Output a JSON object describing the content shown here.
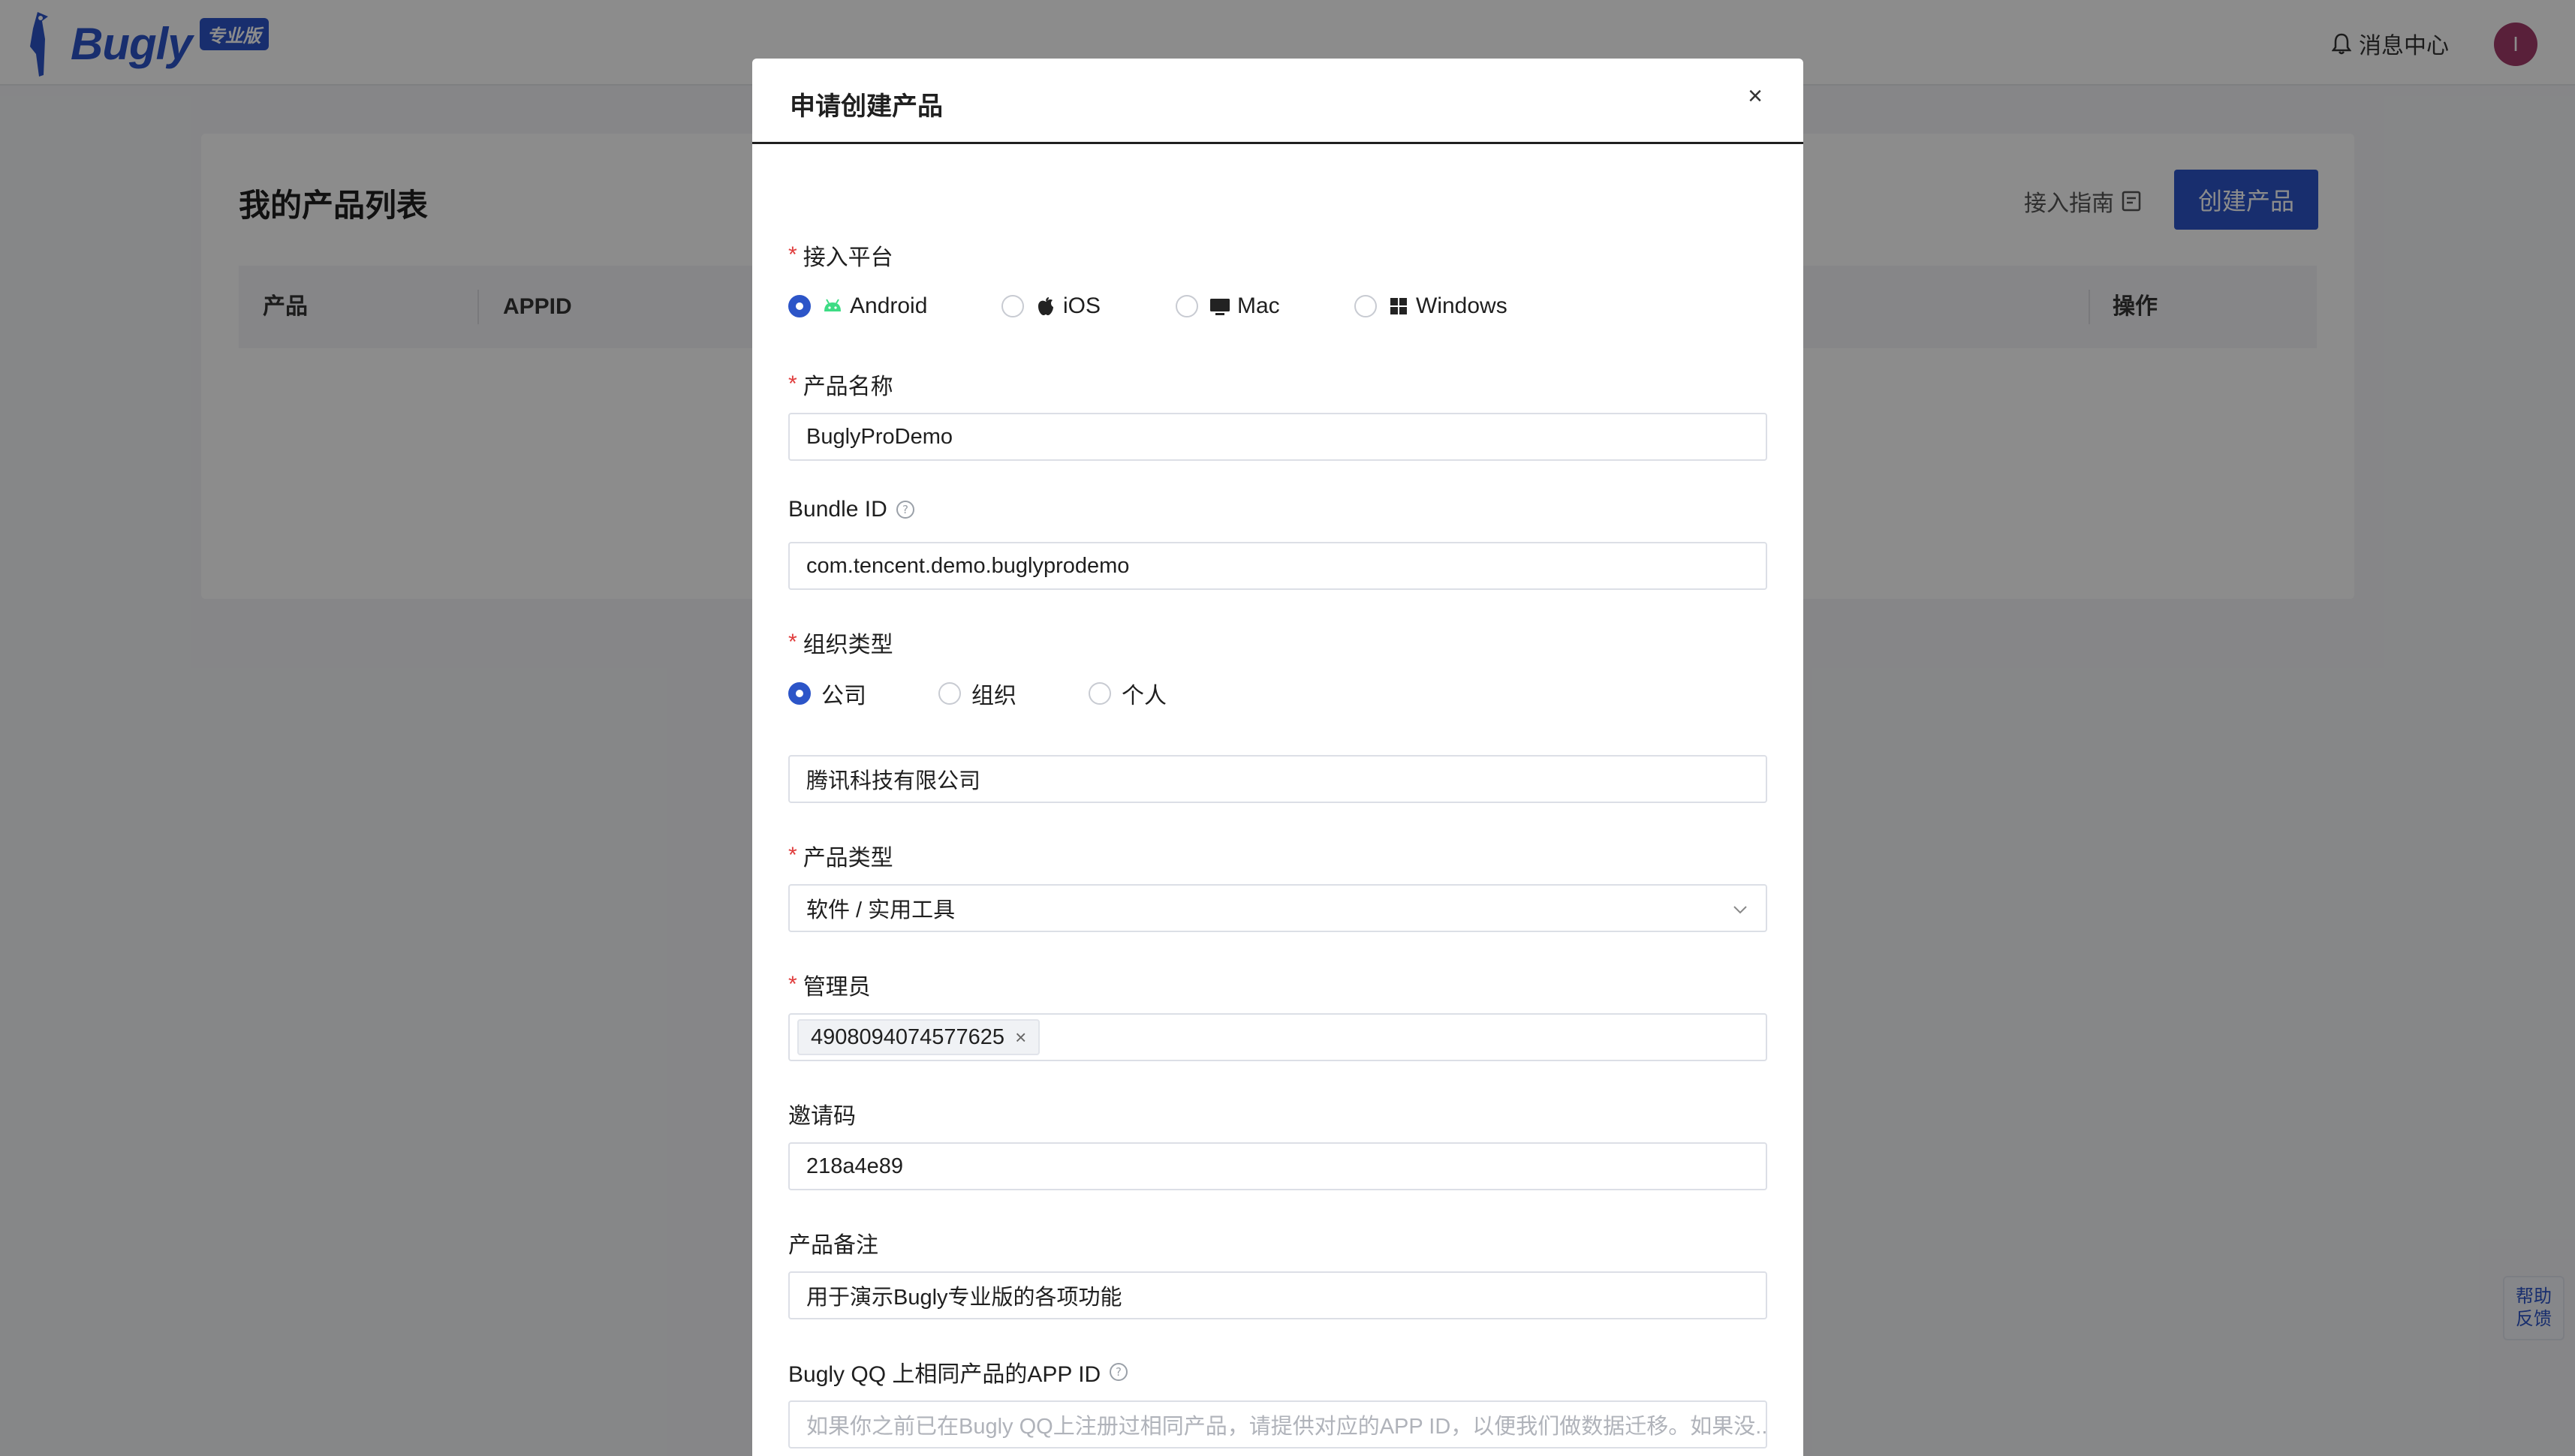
{
  "header": {
    "logo_text": "Bugly",
    "logo_badge": "专业版",
    "message_center": "消息中心",
    "avatar_initial": "I"
  },
  "page": {
    "title": "我的产品列表",
    "guide_link": "接入指南",
    "create_button": "创建产品",
    "table_headers": [
      "产品",
      "APPID",
      "操作"
    ]
  },
  "modal": {
    "title": "申请创建产品",
    "close": "×",
    "platform": {
      "label": "接入平台",
      "options": [
        "Android",
        "iOS",
        "Mac",
        "Windows"
      ],
      "selected": "Android"
    },
    "product_name": {
      "label": "产品名称",
      "value": "BuglyProDemo"
    },
    "bundle_id": {
      "label": "Bundle ID",
      "value": "com.tencent.demo.buglyprodemo"
    },
    "org_type": {
      "label": "组织类型",
      "options": [
        "公司",
        "组织",
        "个人"
      ],
      "selected": "公司",
      "company_value": "腾讯科技有限公司"
    },
    "product_type": {
      "label": "产品类型",
      "value": "软件 / 实用工具"
    },
    "admin": {
      "label": "管理员",
      "tag": "4908094074577625"
    },
    "invite_code": {
      "label": "邀请码",
      "value": "218a4e89"
    },
    "product_note": {
      "label": "产品备注",
      "value": "用于演示Bugly专业版的各项功能"
    },
    "qq_app_id": {
      "label": "Bugly QQ 上相同产品的APP ID",
      "placeholder": "如果你之前已在Bugly QQ上注册过相同产品，请提供对应的APP ID，以便我们做数据迁移。如果没..."
    }
  },
  "help_widget": {
    "line1": "帮助",
    "line2": "反馈"
  },
  "colors": {
    "brand": "#2c55c8",
    "required": "#e03c3c",
    "avatar": "#a23b6a",
    "android_green": "#3ddc84"
  }
}
